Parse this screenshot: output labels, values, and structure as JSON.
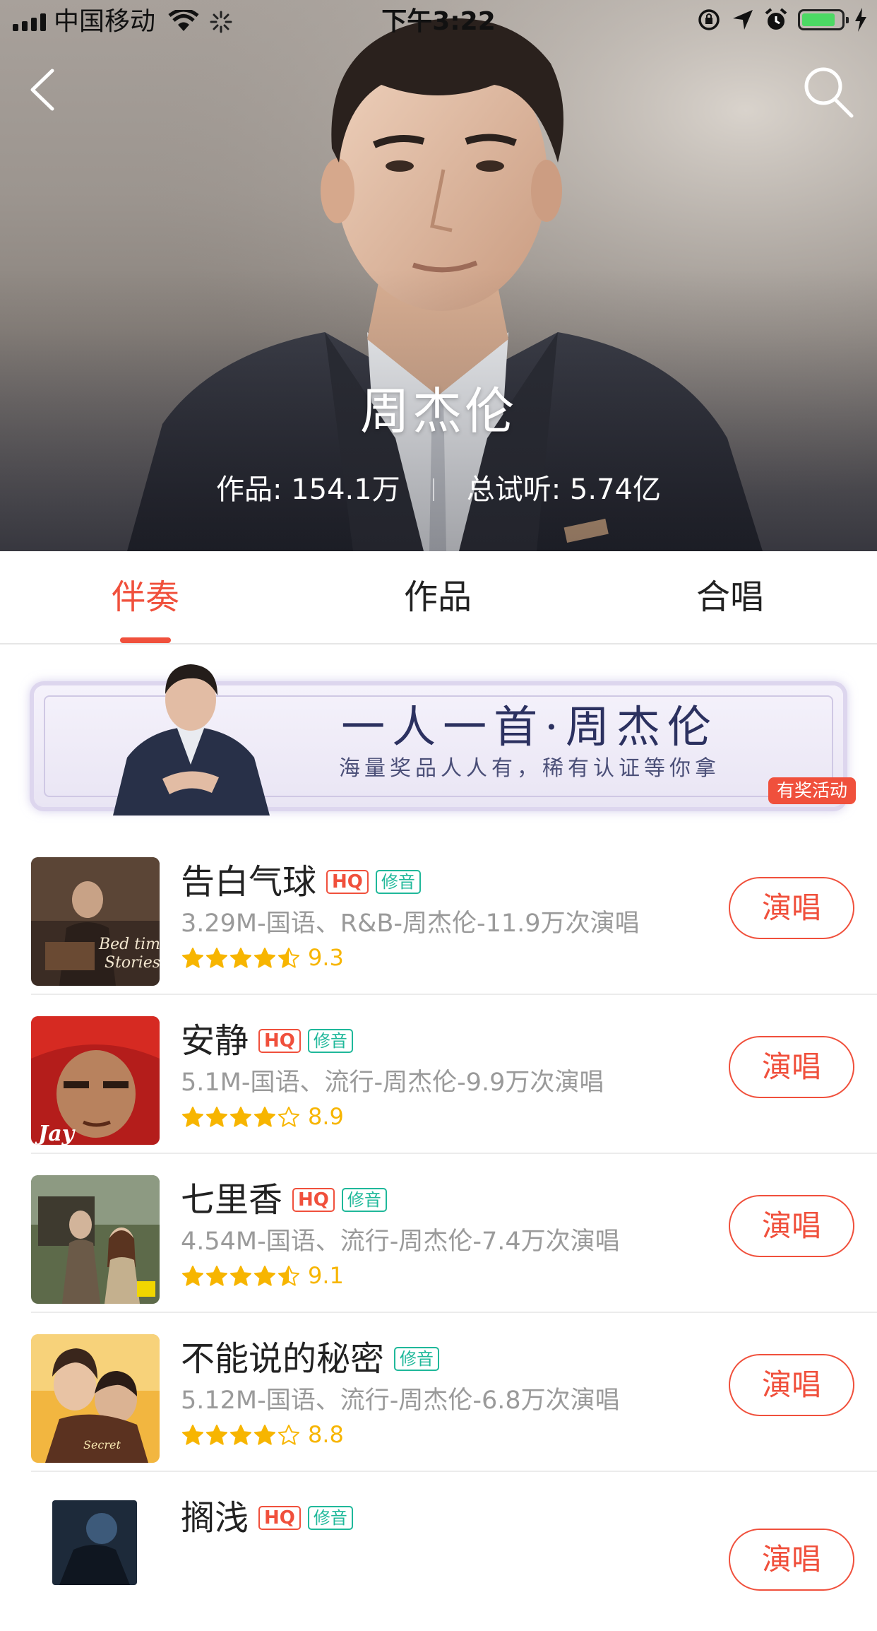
{
  "status_bar": {
    "carrier": "中国移动",
    "time": "下午3:22",
    "battery_level": 0.85
  },
  "colors": {
    "accent": "#f0503c",
    "tag_fix": "#1fb89a",
    "star": "#f7b500",
    "meta_text": "#9a9a9a"
  },
  "hero": {
    "artist_name": "周杰伦",
    "works_stat": "作品: 154.1万",
    "listens_stat": "总试听: 5.74亿",
    "back_icon": "chevron-left-icon",
    "search_icon": "search-icon"
  },
  "tabs": [
    {
      "label": "伴奏",
      "active": true
    },
    {
      "label": "作品",
      "active": false
    },
    {
      "label": "合唱",
      "active": false
    }
  ],
  "banner": {
    "title": "一人一首·周杰伦",
    "subtitle": "海量奖品人人有，稀有认证等你拿",
    "badge": "有奖活动"
  },
  "songs": [
    {
      "title": "告白气球",
      "hq": "HQ",
      "tag": "修音",
      "meta": "3.29M-国语、R&B-周杰伦-11.9万次演唱",
      "stars": 4.5,
      "score": "9.3",
      "button": "演唱"
    },
    {
      "title": "安静",
      "hq": "HQ",
      "tag": "修音",
      "meta": "5.1M-国语、流行-周杰伦-9.9万次演唱",
      "stars": 4,
      "score": "8.9",
      "button": "演唱"
    },
    {
      "title": "七里香",
      "hq": "HQ",
      "tag": "修音",
      "meta": "4.54M-国语、流行-周杰伦-7.4万次演唱",
      "stars": 4.5,
      "score": "9.1",
      "button": "演唱"
    },
    {
      "title": "不能说的秘密",
      "hq": "",
      "tag": "修音",
      "meta": "5.12M-国语、流行-周杰伦-6.8万次演唱",
      "stars": 4,
      "score": "8.8",
      "button": "演唱"
    },
    {
      "title": "搁浅",
      "hq": "HQ",
      "tag": "修音",
      "meta": "",
      "stars": 0,
      "score": "",
      "button": "演唱"
    }
  ]
}
